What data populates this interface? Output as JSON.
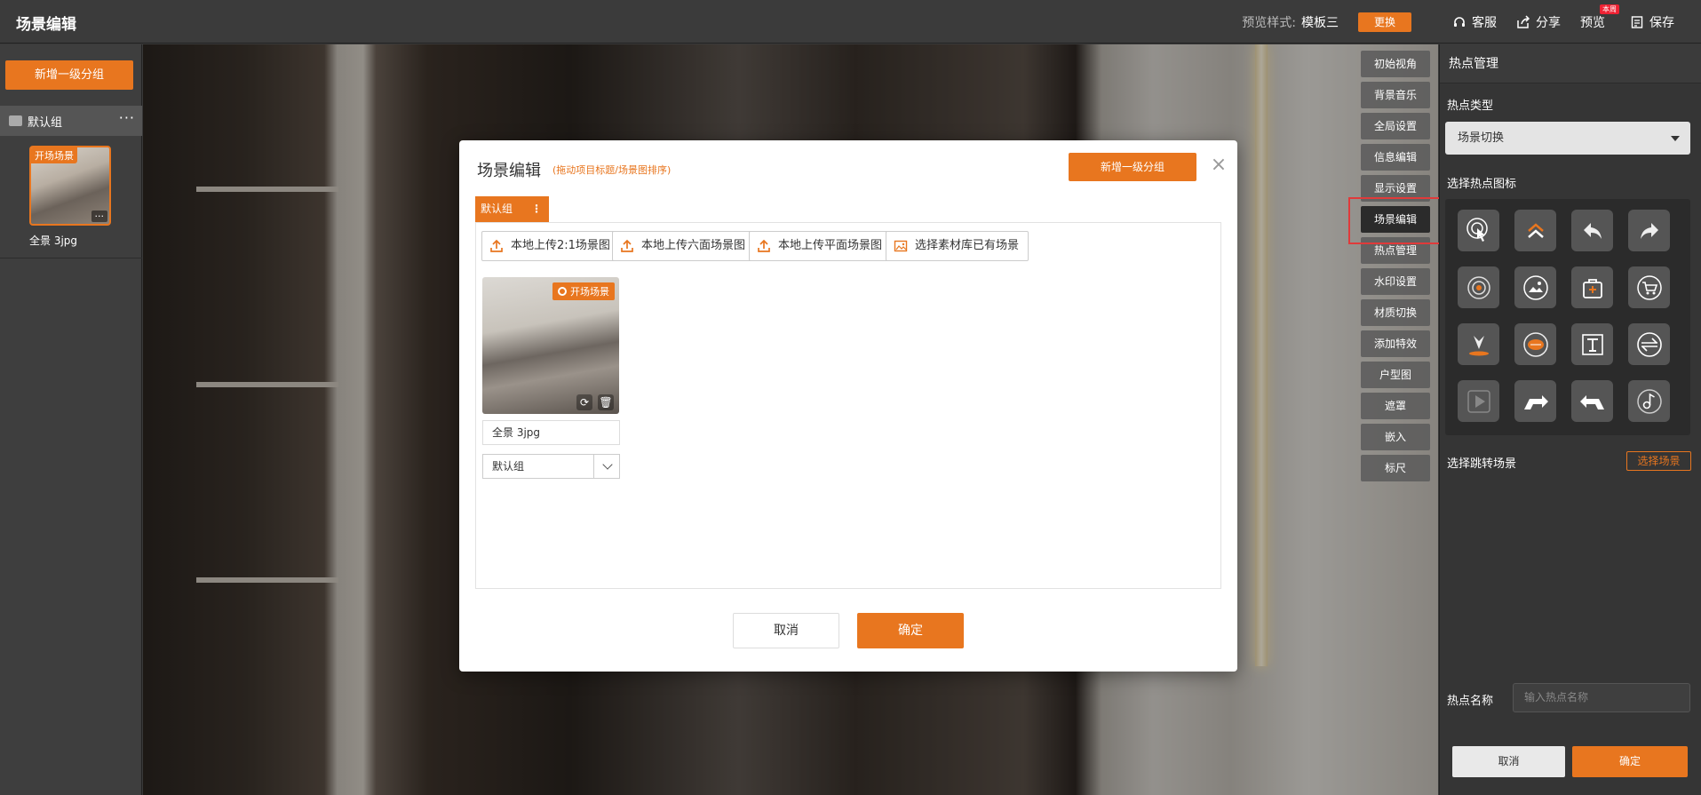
{
  "header": {
    "title": "场景编辑",
    "preview_style_label": "预览样式:",
    "preview_style_value": "模板三",
    "change_label": "更换",
    "service_label": "客服",
    "share_label": "分享",
    "preview_label": "预览",
    "preview_badge": "本周",
    "save_label": "保存"
  },
  "left": {
    "add_group_label": "新增一级分组",
    "group_name": "默认组",
    "group_more": "···",
    "scene_tag": "开场场景",
    "scene_more": "···",
    "scene_name": "全景 3jpg"
  },
  "tools": [
    {
      "label": "初始视角"
    },
    {
      "label": "背景音乐"
    },
    {
      "label": "全局设置"
    },
    {
      "label": "信息编辑"
    },
    {
      "label": "显示设置"
    },
    {
      "label": "场景编辑"
    },
    {
      "label": "热点管理"
    },
    {
      "label": "水印设置"
    },
    {
      "label": "材质切换"
    },
    {
      "label": "添加特效"
    },
    {
      "label": "户型图"
    },
    {
      "label": "遮罩"
    },
    {
      "label": "嵌入"
    },
    {
      "label": "标尺"
    }
  ],
  "right": {
    "header": "热点管理",
    "hotspot_type_label": "热点类型",
    "hotspot_type_value": "场景切换",
    "choose_icon_label": "选择热点图标",
    "jump_scene_label": "选择跳转场景",
    "choose_scene_button": "选择场景",
    "hotspot_name_label": "热点名称",
    "hotspot_name_placeholder": "输入热点名称",
    "cancel_label": "取消",
    "ok_label": "确定"
  },
  "modal": {
    "title": "场景编辑",
    "subtitle": "(拖动项目标题/场景图排序)",
    "add_group_label": "新增一级分组",
    "tab_label": "默认组",
    "tab_more": "⋮",
    "upload_buttons": [
      {
        "label": "本地上传2:1场景图"
      },
      {
        "label": "本地上传六面场景图"
      },
      {
        "label": "本地上传平面场景图"
      },
      {
        "label": "选择素材库已有场景"
      }
    ],
    "card_tag": "开场场景",
    "card_name": "全景 3jpg",
    "card_group": "默认组",
    "cancel_label": "取消",
    "ok_label": "确定"
  },
  "colors": {
    "accent": "#e8761f",
    "highlight": "#e03a3a"
  }
}
